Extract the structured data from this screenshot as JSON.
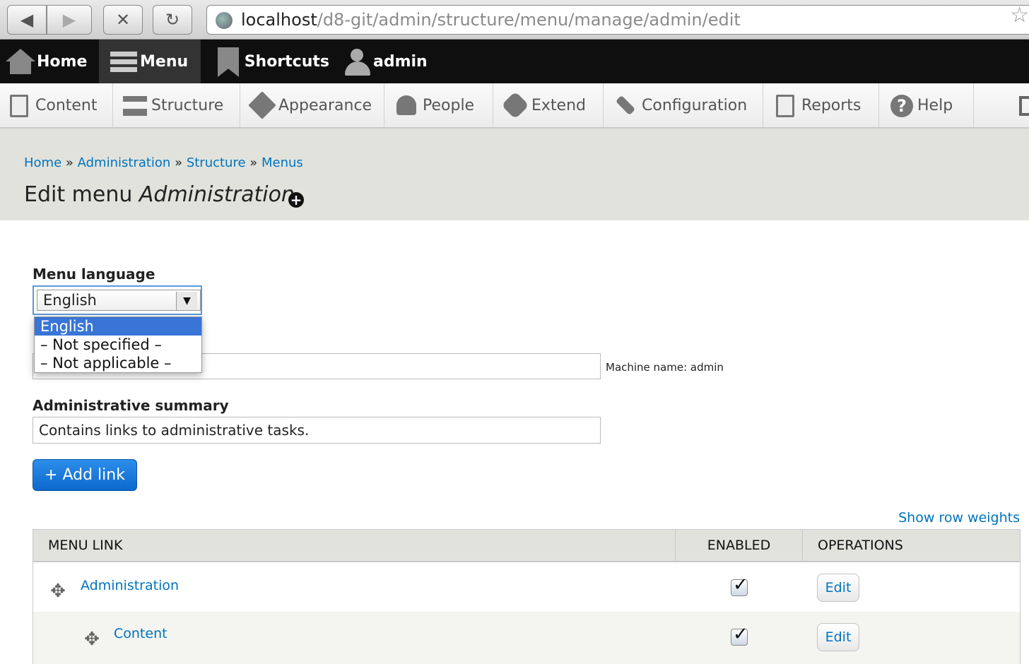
{
  "browser": {
    "url_host": "localhost",
    "url_path": "/d8-git/admin/structure/menu/manage/admin/edit"
  },
  "toolbar": {
    "home": "Home",
    "menu": "Menu",
    "shortcuts": "Shortcuts",
    "admin": "admin"
  },
  "tray": {
    "items": [
      "Content",
      "Structure",
      "Appearance",
      "People",
      "Extend",
      "Configuration",
      "Reports",
      "Help"
    ]
  },
  "breadcrumb": [
    "Home",
    "Administration",
    "Structure",
    "Menus"
  ],
  "page_title_prefix": "Edit menu ",
  "page_title_name": "Administration",
  "form": {
    "menu_language_label": "Menu language",
    "menu_language_value": "English",
    "language_options": [
      "English",
      "– Not specified –",
      "– Not applicable –"
    ],
    "machine_name": "Machine name: admin",
    "summary_label": "Administrative summary",
    "summary_value": "Contains links to administrative tasks.",
    "add_link": "+ Add link"
  },
  "table": {
    "show_row_weights": "Show row weights",
    "headers": [
      "MENU LINK",
      "ENABLED",
      "OPERATIONS"
    ],
    "rows": [
      {
        "label": "Administration",
        "enabled": true,
        "op": "Edit"
      },
      {
        "label": "Content",
        "enabled": true,
        "op": "Edit"
      }
    ]
  },
  "colors": {
    "link": "#0074bd",
    "toolbar_bg": "#0f0f0f",
    "header_bg": "#e1e2dc",
    "primary_button": "#1a7adb",
    "selected_option": "#3875d7"
  }
}
